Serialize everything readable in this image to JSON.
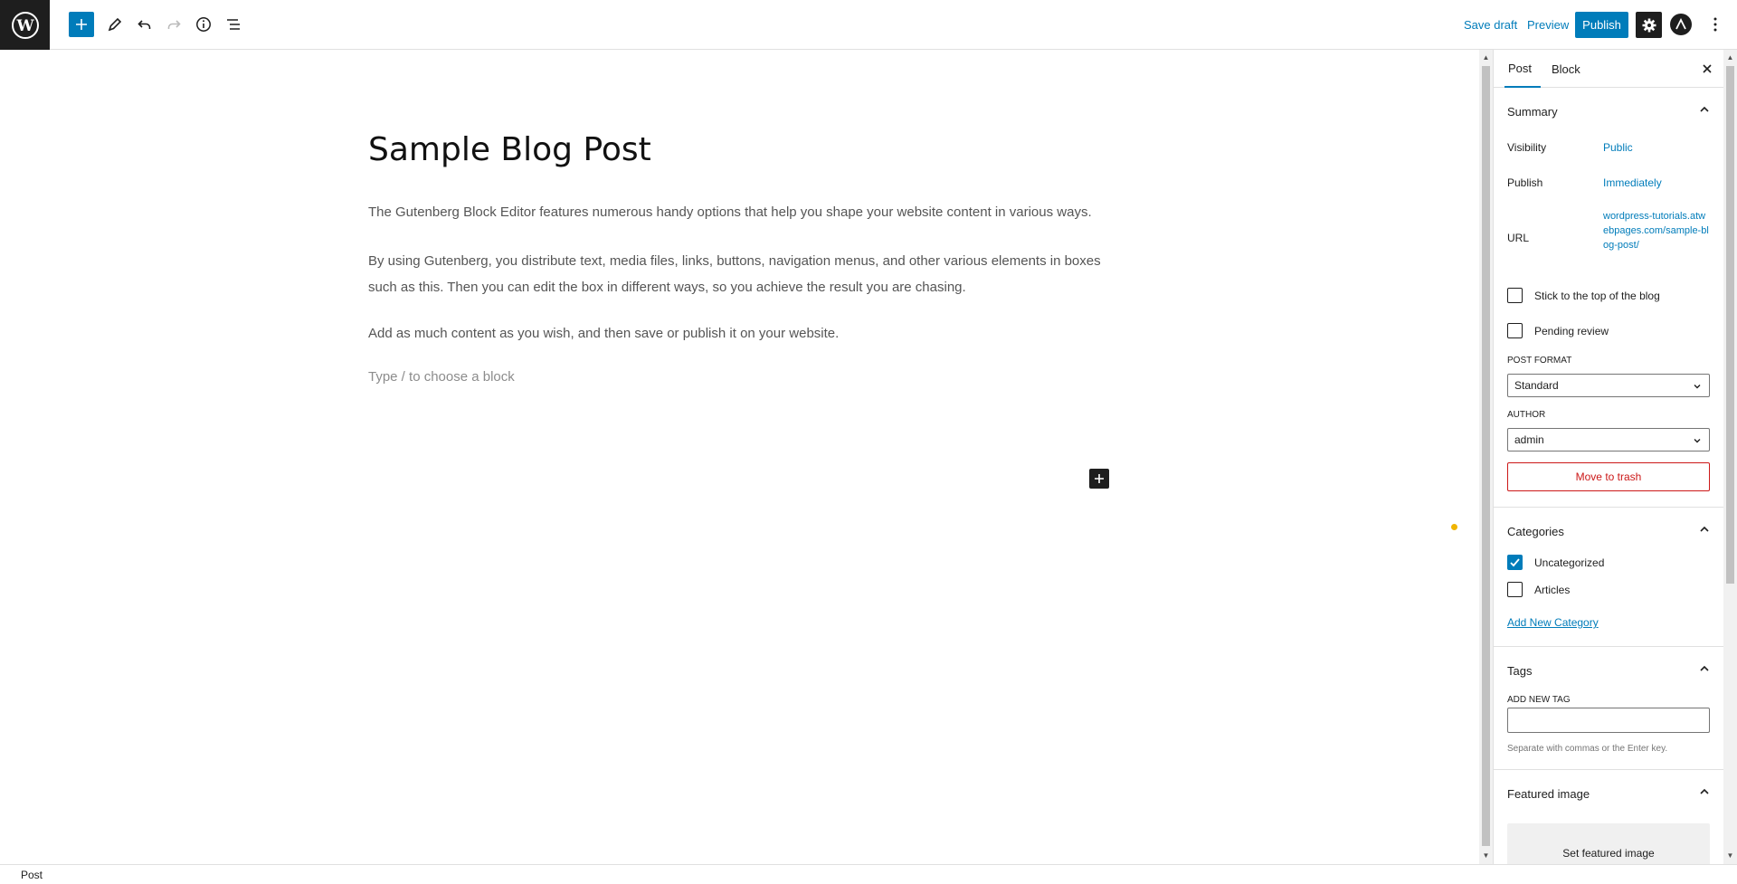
{
  "topbar": {
    "save_draft": "Save draft",
    "preview": "Preview",
    "publish": "Publish"
  },
  "canvas": {
    "title": "Sample Blog Post",
    "paragraphs": [
      "The Gutenberg Block Editor features numerous handy options that help you shape your website content in various ways.",
      "By using Gutenberg, you distribute text, media files, links, buttons, navigation menus, and other various elements in boxes such as this. Then you can edit the box in different ways, so you achieve the result you are chasing.",
      "Add as much content as you wish, and then save or publish it on your website."
    ],
    "block_placeholder": "Type / to choose a block"
  },
  "sidebar": {
    "tabs": [
      "Post",
      "Block"
    ],
    "summary": {
      "heading": "Summary",
      "visibility_label": "Visibility",
      "visibility_value": "Public",
      "publish_label": "Publish",
      "publish_value": "Immediately",
      "url_label": "URL",
      "url_value": "wordpress-tutorials.atwebpages.com/sample-blog-post/",
      "sticky_label": "Stick to the top of the blog",
      "sticky_checked": false,
      "pending_label": "Pending review",
      "pending_checked": false,
      "post_format_label": "POST FORMAT",
      "post_format_value": "Standard",
      "author_label": "AUTHOR",
      "author_value": "admin",
      "trash": "Move to trash"
    },
    "categories": {
      "heading": "Categories",
      "items": [
        {
          "label": "Uncategorized",
          "checked": true
        },
        {
          "label": "Articles",
          "checked": false
        }
      ],
      "add_new": "Add New Category"
    },
    "tags": {
      "heading": "Tags",
      "add_label": "ADD NEW TAG",
      "input_value": "",
      "help": "Separate with commas or the Enter key."
    },
    "featured": {
      "heading": "Featured image",
      "set": "Set featured image"
    }
  },
  "footer": {
    "breadcrumb": "Post"
  },
  "colors": {
    "accent": "#007cba",
    "dark": "#1e1e1e",
    "danger": "#cc1818",
    "indicator": "#f0b400"
  }
}
